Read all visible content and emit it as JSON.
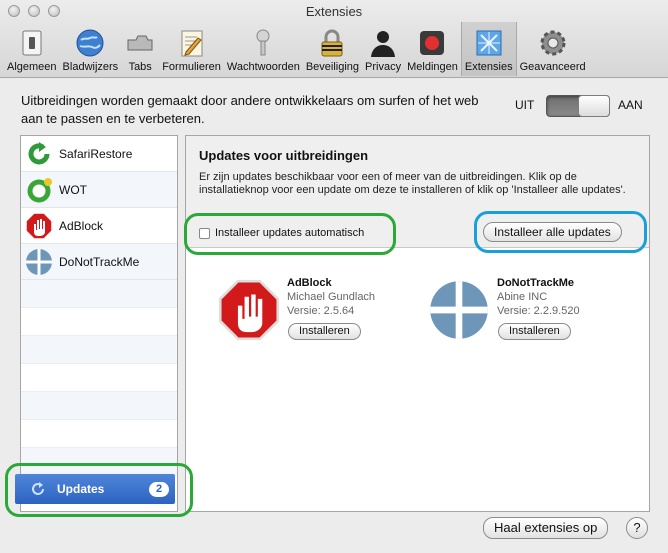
{
  "window": {
    "title": "Extensies"
  },
  "toolbar": [
    {
      "label": "Algemeen",
      "icon": "switch-icon"
    },
    {
      "label": "Bladwijzers",
      "icon": "globe-icon"
    },
    {
      "label": "Tabs",
      "icon": "tabs-icon"
    },
    {
      "label": "Formulieren",
      "icon": "pencil-form-icon"
    },
    {
      "label": "Wachtwoorden",
      "icon": "key-icon"
    },
    {
      "label": "Beveiliging",
      "icon": "lock-icon"
    },
    {
      "label": "Privacy",
      "icon": "person-silhouette-icon"
    },
    {
      "label": "Meldingen",
      "icon": "record-icon"
    },
    {
      "label": "Extensies",
      "icon": "puzzle-icon",
      "active": true
    },
    {
      "label": "Geavanceerd",
      "icon": "gear-icon"
    }
  ],
  "header": {
    "intro": "Uitbreidingen worden gemaakt door andere ontwikkelaars om surfen of het web aan te passen en te verbeteren.",
    "toggle_off": "UIT",
    "toggle_on": "AAN"
  },
  "sidebar": {
    "extensions": [
      {
        "label": "SafariRestore",
        "icon": "restore-arrow-icon"
      },
      {
        "label": "WOT",
        "icon": "wot-ring-icon"
      },
      {
        "label": "AdBlock",
        "icon": "stop-hand-icon"
      },
      {
        "label": "DoNotTrackMe",
        "icon": "crosshair-globe-icon"
      }
    ],
    "updates": {
      "label": "Updates",
      "count": "2",
      "icon": "refresh-icon"
    }
  },
  "panel": {
    "title": "Updates voor uitbreidingen",
    "description": "Er zijn updates beschikbaar voor een of meer van de uitbreidingen. Klik op de installatieknop voor een update om deze te installeren of klik op 'Installeer alle updates'.",
    "auto_checkbox": {
      "label": "Installeer updates automatisch",
      "checked": false
    },
    "install_all": "Installeer alle updates",
    "updates": [
      {
        "name": "AdBlock",
        "author": "Michael Gundlach",
        "version": "Versie: 2.5.64",
        "button": "Installeren",
        "icon": "stop-hand-icon"
      },
      {
        "name": "DoNotTrackMe",
        "author": "Abine INC",
        "version": "Versie: 2.2.9.520",
        "button": "Installeren",
        "icon": "crosshair-globe-icon"
      }
    ]
  },
  "footer": {
    "get_extensions": "Haal extensies op",
    "help": "?"
  },
  "colors": {
    "highlight_green": "#2aa838",
    "highlight_blue": "#1aa0d8",
    "selection_blue": "#2c63c2"
  }
}
